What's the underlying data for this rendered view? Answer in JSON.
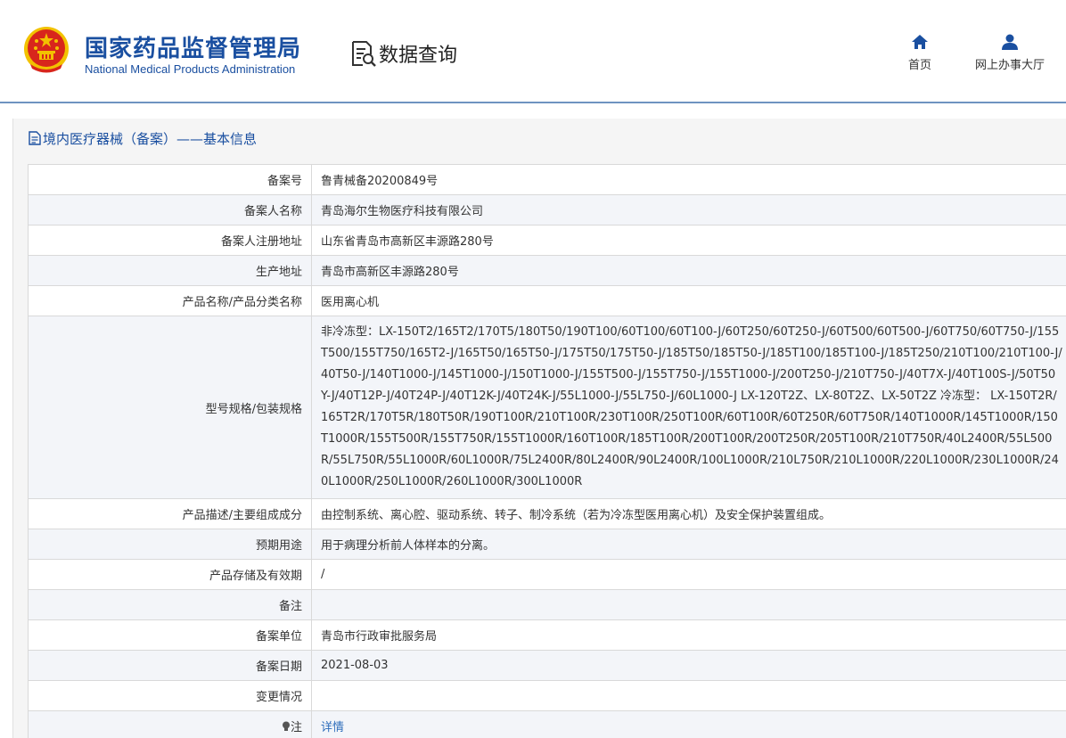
{
  "header": {
    "org_name_cn": "国家药品监督管理局",
    "org_name_en": "National Medical Products Administration",
    "section_title": "数据查询",
    "nav": [
      {
        "label": "首页",
        "icon": "home-icon"
      },
      {
        "label": "网上办事大厅",
        "icon": "user-icon"
      }
    ]
  },
  "panel": {
    "title": "境内医疗器械（备案）——基本信息",
    "title_icon": "document-icon"
  },
  "rows": [
    {
      "label": "备案号",
      "value": "鲁青械备20200849号"
    },
    {
      "label": "备案人名称",
      "value": "青岛海尔生物医疗科技有限公司"
    },
    {
      "label": "备案人注册地址",
      "value": "山东省青岛市高新区丰源路280号"
    },
    {
      "label": "生产地址",
      "value": "青岛市高新区丰源路280号"
    },
    {
      "label": "产品名称/产品分类名称",
      "value": "医用离心机"
    },
    {
      "label": "型号规格/包装规格",
      "value": "非冷冻型：LX-150T2/165T2/170T5/180T50/190T100/60T100/60T100-J/60T250/60T250-J/60T500/60T500-J/60T750/60T750-J/155T500/155T750/165T2-J/165T50/165T50-J/175T50/175T50-J/185T50/185T50-J/185T100/185T100-J/185T250/210T100/210T100-J/40T50-J/140T1000-J/145T1000-J/150T1000-J/155T500-J/155T750-J/155T1000-J/200T250-J/210T750-J/40T7X-J/40T100S-J/50T50Y-J/40T12P-J/40T24P-J/40T12K-J/40T24K-J/55L1000-J/55L750-J/60L1000-J LX-120T2Z、LX-80T2Z、LX-50T2Z 冷冻型： LX-150T2R/165T2R/170T5R/180T50R/190T100R/210T100R/230T100R/250T100R/60T100R/60T250R/60T750R/140T1000R/145T1000R/150T1000R/155T500R/155T750R/155T1000R/160T100R/185T100R/200T100R/200T250R/205T100R/210T750R/40L2400R/55L500R/55L750R/55L1000R/60L1000R/75L2400R/80L2400R/90L2400R/100L1000R/210L750R/210L1000R/220L1000R/230L1000R/240L1000R/250L1000R/260L1000R/300L1000R"
    },
    {
      "label": "产品描述/主要组成成分",
      "value": "由控制系统、离心腔、驱动系统、转子、制冷系统（若为冷冻型医用离心机）及安全保护装置组成。"
    },
    {
      "label": "预期用途",
      "value": "用于病理分析前人体样本的分离。"
    },
    {
      "label": "产品存储及有效期",
      "value": "/"
    },
    {
      "label": "备注",
      "value": ""
    },
    {
      "label": "备案单位",
      "value": "青岛市行政审批服务局"
    },
    {
      "label": "备案日期",
      "value": "2021-08-03"
    },
    {
      "label": "变更情况",
      "value": ""
    },
    {
      "label": "注",
      "value": "详情",
      "label_icon": "bulb-icon"
    }
  ],
  "colors": {
    "brand_blue": "#1a4fa0",
    "link_blue": "#2e6dbb",
    "header_rule": "#6e93c0",
    "emblem_red": "#d8261c",
    "emblem_gold": "#f2c200"
  }
}
